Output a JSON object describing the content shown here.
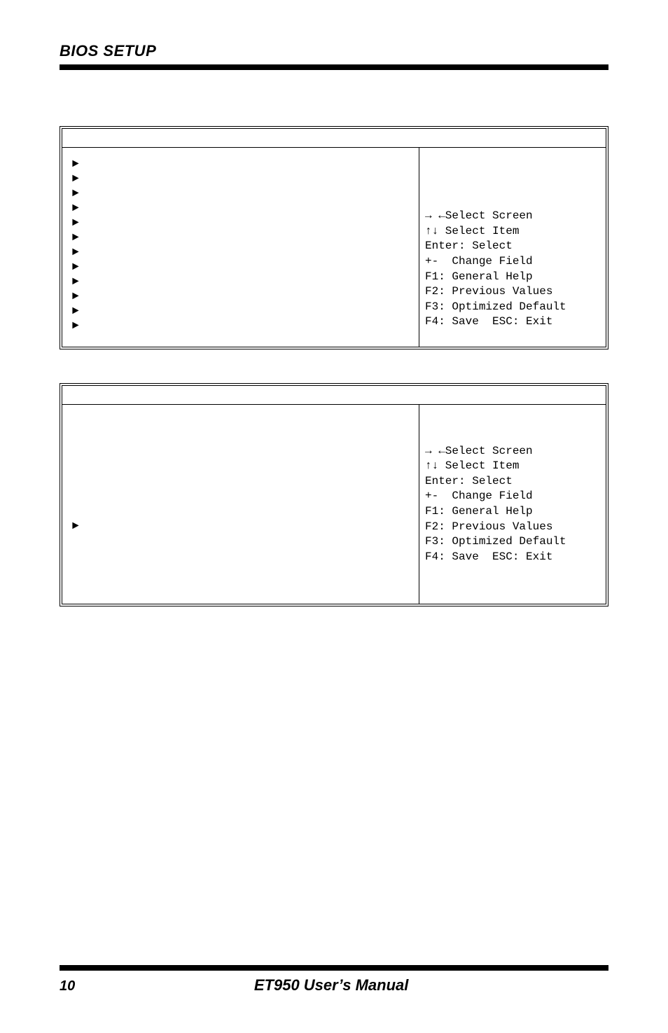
{
  "header": {
    "title": "BIOS SETUP"
  },
  "table1": {
    "help": {
      "l1": "→ ←Select Screen",
      "l2": "↑↓ Select Item",
      "l3": "Enter: Select",
      "l4": "+-  Change Field",
      "l5": "F1: General Help",
      "l6": "F2: Previous Values",
      "l7": "F3: Optimized Default",
      "l8": "F4: Save  ESC: Exit"
    }
  },
  "table2": {
    "help": {
      "l1": "→ ←Select Screen",
      "l2": "↑↓ Select Item",
      "l3": "Enter: Select",
      "l4": "+-  Change Field",
      "l5": "F1: General Help",
      "l6": "F2: Previous Values",
      "l7": "F3: Optimized Default",
      "l8": "F4: Save  ESC: Exit"
    }
  },
  "footer": {
    "page": "10",
    "manual": "ET950 User’s Manual"
  }
}
